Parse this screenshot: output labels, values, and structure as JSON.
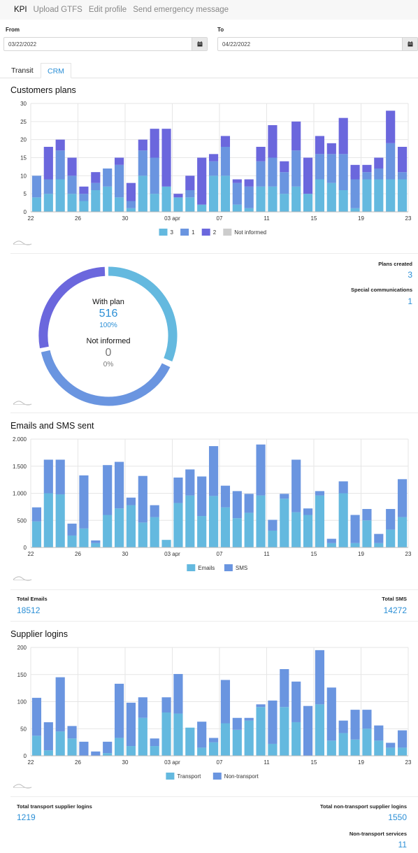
{
  "nav": [
    "KPI",
    "Upload GTFS",
    "Edit profile",
    "Send emergency message"
  ],
  "filters": {
    "from_label": "From",
    "from_value": "03/22/2022",
    "to_label": "To",
    "to_value": "04/22/2022"
  },
  "tabs": [
    "Transit",
    "CRM"
  ],
  "colors": {
    "light": "#64b9df",
    "mid": "#6a95e0",
    "dark": "#6b67dd",
    "gray": "#cccccc",
    "accent": "#2b8fd6"
  },
  "customers_plans": {
    "title": "Customers plans",
    "chart_data": {
      "type": "bar",
      "stacked": true,
      "ylim": [
        0,
        30
      ],
      "yticks": [
        "0",
        "5",
        "10",
        "15",
        "20",
        "25",
        "30"
      ],
      "xticks": [
        {
          "i": 0,
          "label": "22"
        },
        {
          "i": 4,
          "label": "26"
        },
        {
          "i": 8,
          "label": "30"
        },
        {
          "i": 12,
          "label": "03 apr"
        },
        {
          "i": 16,
          "label": "07"
        },
        {
          "i": 20,
          "label": "11"
        },
        {
          "i": 24,
          "label": "15"
        },
        {
          "i": 28,
          "label": "19"
        },
        {
          "i": 32,
          "label": "23"
        }
      ],
      "series": [
        {
          "name": "3",
          "values": [
            4,
            5,
            9,
            5,
            3,
            6,
            7,
            4,
            1,
            10,
            5,
            7,
            4,
            4,
            2,
            10,
            10,
            2,
            1,
            7,
            7,
            5,
            7,
            5,
            9,
            8,
            6,
            1,
            9,
            9,
            9,
            9
          ]
        },
        {
          "name": "1",
          "values": [
            6,
            4,
            8,
            5,
            2,
            2,
            5,
            9,
            2,
            7,
            10,
            0,
            0,
            2,
            0,
            4,
            8,
            6,
            6,
            7,
            8,
            6,
            10,
            0,
            7,
            8,
            10,
            8,
            2,
            3,
            10,
            2
          ]
        },
        {
          "name": "2",
          "values": [
            0,
            9,
            3,
            5,
            2,
            3,
            0,
            2,
            5,
            3,
            8,
            16,
            1,
            4,
            13,
            2,
            3,
            1,
            2,
            4,
            9,
            3,
            8,
            10,
            5,
            3,
            10,
            4,
            2,
            3,
            9,
            7
          ]
        },
        {
          "name": "Not informed",
          "values": [
            0,
            0,
            0,
            0,
            0,
            0,
            0,
            0,
            0,
            0,
            0,
            0,
            0,
            0,
            0,
            0,
            0,
            0,
            0,
            0,
            0,
            0,
            0,
            0,
            0,
            0,
            0,
            0,
            0,
            0,
            0,
            0
          ]
        }
      ]
    }
  },
  "donut": {
    "with_plan_label": "With plan",
    "with_plan_value": "516",
    "with_plan_pct": "100%",
    "not_informed_label": "Not informed",
    "not_informed_value": "0",
    "not_informed_pct": "0%",
    "stats": [
      {
        "label": "Plans created",
        "value": "3"
      },
      {
        "label": "Special communications",
        "value": "1"
      }
    ]
  },
  "emails_sms": {
    "title": "Emails and SMS sent",
    "chart_data": {
      "type": "bar",
      "stacked": true,
      "ylim": [
        0,
        2000
      ],
      "yticks": [
        "0",
        "500",
        "1.000",
        "1.500",
        "2.000"
      ],
      "xticks": [
        {
          "i": 0,
          "label": "22"
        },
        {
          "i": 4,
          "label": "26"
        },
        {
          "i": 8,
          "label": "30"
        },
        {
          "i": 12,
          "label": "03 apr"
        },
        {
          "i": 16,
          "label": "07"
        },
        {
          "i": 20,
          "label": "11"
        },
        {
          "i": 24,
          "label": "15"
        },
        {
          "i": 28,
          "label": "19"
        },
        {
          "i": 32,
          "label": "23"
        }
      ],
      "series": [
        {
          "name": "Emails",
          "values": [
            480,
            1000,
            980,
            220,
            350,
            80,
            600,
            720,
            780,
            460,
            560,
            140,
            820,
            960,
            580,
            950,
            740,
            540,
            640,
            960,
            310,
            900,
            650,
            600,
            960,
            80,
            1000,
            80,
            500,
            80,
            330,
            560
          ]
        },
        {
          "name": "SMS",
          "values": [
            260,
            620,
            640,
            220,
            980,
            50,
            920,
            860,
            140,
            860,
            220,
            0,
            470,
            480,
            730,
            920,
            400,
            500,
            350,
            940,
            200,
            90,
            970,
            120,
            80,
            80,
            220,
            520,
            210,
            170,
            380,
            700
          ]
        }
      ]
    },
    "totals": [
      {
        "label": "Total Emails",
        "value": "18512"
      },
      {
        "label": "Total SMS",
        "value": "14272"
      }
    ]
  },
  "supplier_logins": {
    "title": "Supplier logins",
    "chart_data": {
      "type": "bar",
      "stacked": true,
      "ylim": [
        0,
        200
      ],
      "yticks": [
        "0",
        "50",
        "100",
        "150",
        "200"
      ],
      "xticks": [
        {
          "i": 0,
          "label": "22"
        },
        {
          "i": 4,
          "label": "26"
        },
        {
          "i": 8,
          "label": "30"
        },
        {
          "i": 12,
          "label": "03 apr"
        },
        {
          "i": 16,
          "label": "07"
        },
        {
          "i": 20,
          "label": "11"
        },
        {
          "i": 24,
          "label": "15"
        },
        {
          "i": 28,
          "label": "19"
        },
        {
          "i": 32,
          "label": "23"
        }
      ],
      "series": [
        {
          "name": "Transport",
          "values": [
            37,
            10,
            45,
            32,
            0,
            0,
            5,
            33,
            18,
            70,
            18,
            80,
            78,
            52,
            15,
            25,
            60,
            48,
            65,
            90,
            22,
            90,
            62,
            0,
            95,
            28,
            42,
            30,
            50,
            28,
            15,
            15
          ]
        },
        {
          "name": "Non-transport",
          "values": [
            70,
            52,
            100,
            23,
            26,
            8,
            21,
            100,
            80,
            38,
            14,
            28,
            73,
            0,
            48,
            8,
            80,
            22,
            5,
            5,
            80,
            70,
            75,
            92,
            100,
            98,
            23,
            55,
            35,
            28,
            9,
            32
          ]
        }
      ]
    },
    "totals": [
      {
        "label": "Total transport supplier logins",
        "value": "1219"
      },
      {
        "label": "Total non-transport supplier logins",
        "value": "1550"
      },
      {
        "label": "Non-transport services",
        "value": "11"
      }
    ]
  }
}
